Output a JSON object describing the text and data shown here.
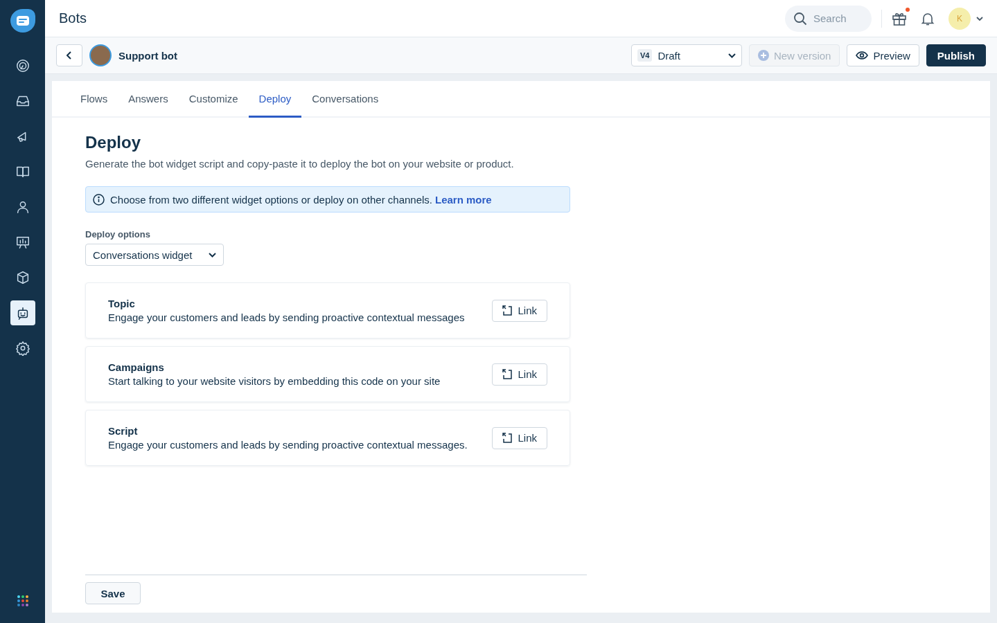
{
  "header": {
    "title": "Bots",
    "search": {
      "placeholder": "Search"
    },
    "gift": {
      "has_notification": true
    },
    "avatar": {
      "initial": "K"
    }
  },
  "sidebar": {
    "items": [
      {
        "selected": false
      },
      {
        "selected": false
      },
      {
        "selected": false
      },
      {
        "selected": false
      },
      {
        "selected": false
      },
      {
        "selected": false
      },
      {
        "selected": false
      },
      {
        "selected": true
      },
      {
        "selected": false
      }
    ]
  },
  "toolbar": {
    "bot_name": "Support bot",
    "version": {
      "badge": "V4",
      "value": "Draft"
    },
    "buttons": [
      {
        "kind": "secondary",
        "label": "New version",
        "disabled": true
      },
      {
        "kind": "preview",
        "label": "Preview",
        "disabled": false
      },
      {
        "kind": "primary",
        "label": "Publish",
        "disabled": false
      }
    ]
  },
  "tabs": [
    {
      "label": "Flows",
      "selected": false
    },
    {
      "label": "Answers",
      "selected": false
    },
    {
      "label": "Customize",
      "selected": false
    },
    {
      "label": "Deploy",
      "selected": true
    },
    {
      "label": "Conversations",
      "selected": false
    }
  ],
  "page": {
    "title": "Deploy",
    "description": "Generate the bot widget script and copy-paste it to deploy the bot on your website or product.",
    "info": {
      "text": "Choose from two different widget options or deploy on other channels.",
      "link": "Learn more"
    },
    "deploy_options": {
      "label": "Deploy options",
      "value": "Conversations widget"
    },
    "cards": [
      {
        "title": "Topic",
        "description": "Engage your customers and leads by sending proactive contextual messages",
        "button": "Link"
      },
      {
        "title": "Campaigns",
        "description": "Start talking to your website visitors by embedding this code on your site",
        "button": "Link"
      },
      {
        "title": "Script",
        "description": "Engage your customers and leads by sending proactive contextual messages.",
        "button": "Link"
      }
    ],
    "save": "Save"
  }
}
